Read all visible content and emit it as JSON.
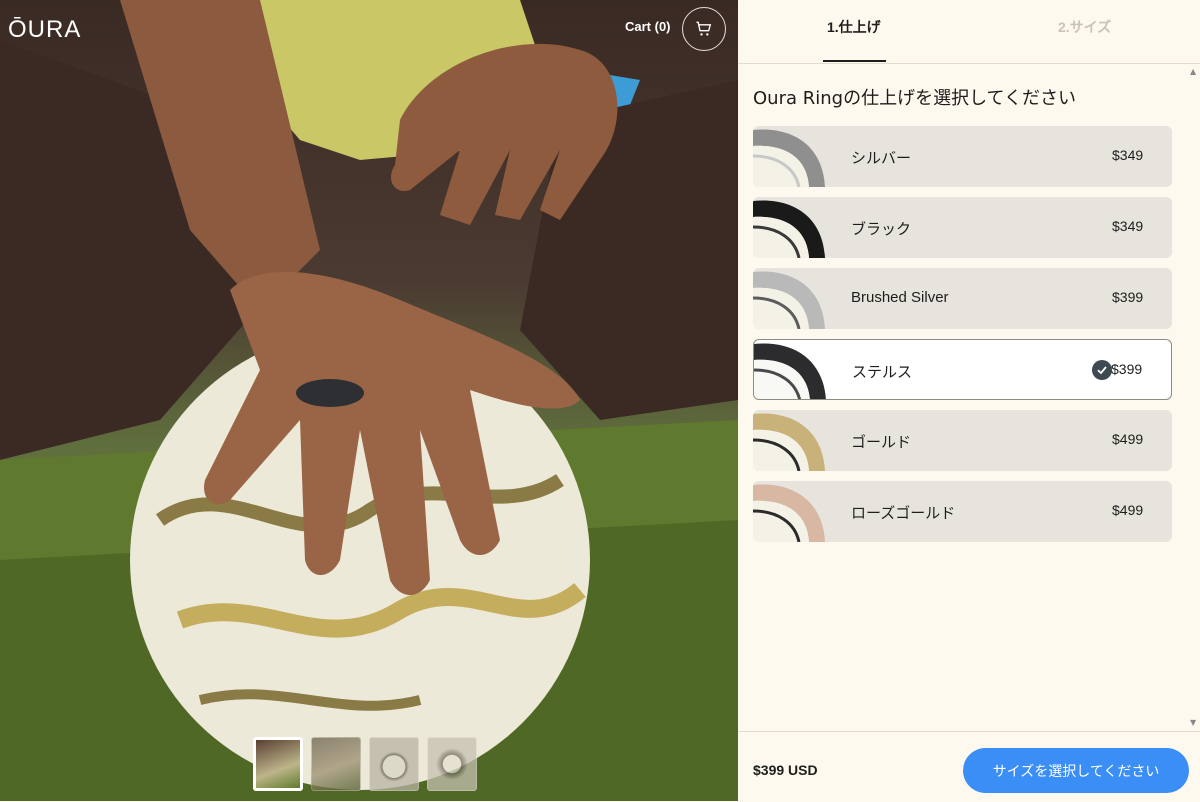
{
  "header": {
    "logo": "ŌURA",
    "cart_label": "Cart (0)"
  },
  "steps": [
    {
      "label": "1.仕上げ",
      "active": true
    },
    {
      "label": "2.サイズ",
      "active": false
    }
  ],
  "heading": "Oura Ringの仕上げを選択してください",
  "options": [
    {
      "name": "シルバー",
      "price": "$349",
      "selected": false,
      "color": "#8f8f8f"
    },
    {
      "name": "ブラック",
      "price": "$349",
      "selected": false,
      "color": "#1a1a1a"
    },
    {
      "name": "Brushed Silver",
      "price": "$399",
      "selected": false,
      "color": "#b9b9b9"
    },
    {
      "name": "ステルス",
      "price": "$399",
      "selected": true,
      "color": "#2c2c2e"
    },
    {
      "name": "ゴールド",
      "price": "$499",
      "selected": false,
      "color": "#c9b27a"
    },
    {
      "name": "ローズゴールド",
      "price": "$499",
      "selected": false,
      "color": "#d9b8a3"
    }
  ],
  "footer": {
    "total": "$399 USD",
    "cta_label": "サイズを選択してください"
  },
  "thumbnails": [
    {
      "icon": "hand-on-ball-thumb",
      "active": true
    },
    {
      "icon": "shoe-thumb",
      "active": false
    },
    {
      "icon": "ring-thumb",
      "active": false
    },
    {
      "icon": "ring-closeup-thumb",
      "active": false
    }
  ],
  "colors": {
    "accent": "#3a8ef5",
    "panel_bg": "#fdf9ee",
    "option_bg": "#e6e4dc"
  }
}
